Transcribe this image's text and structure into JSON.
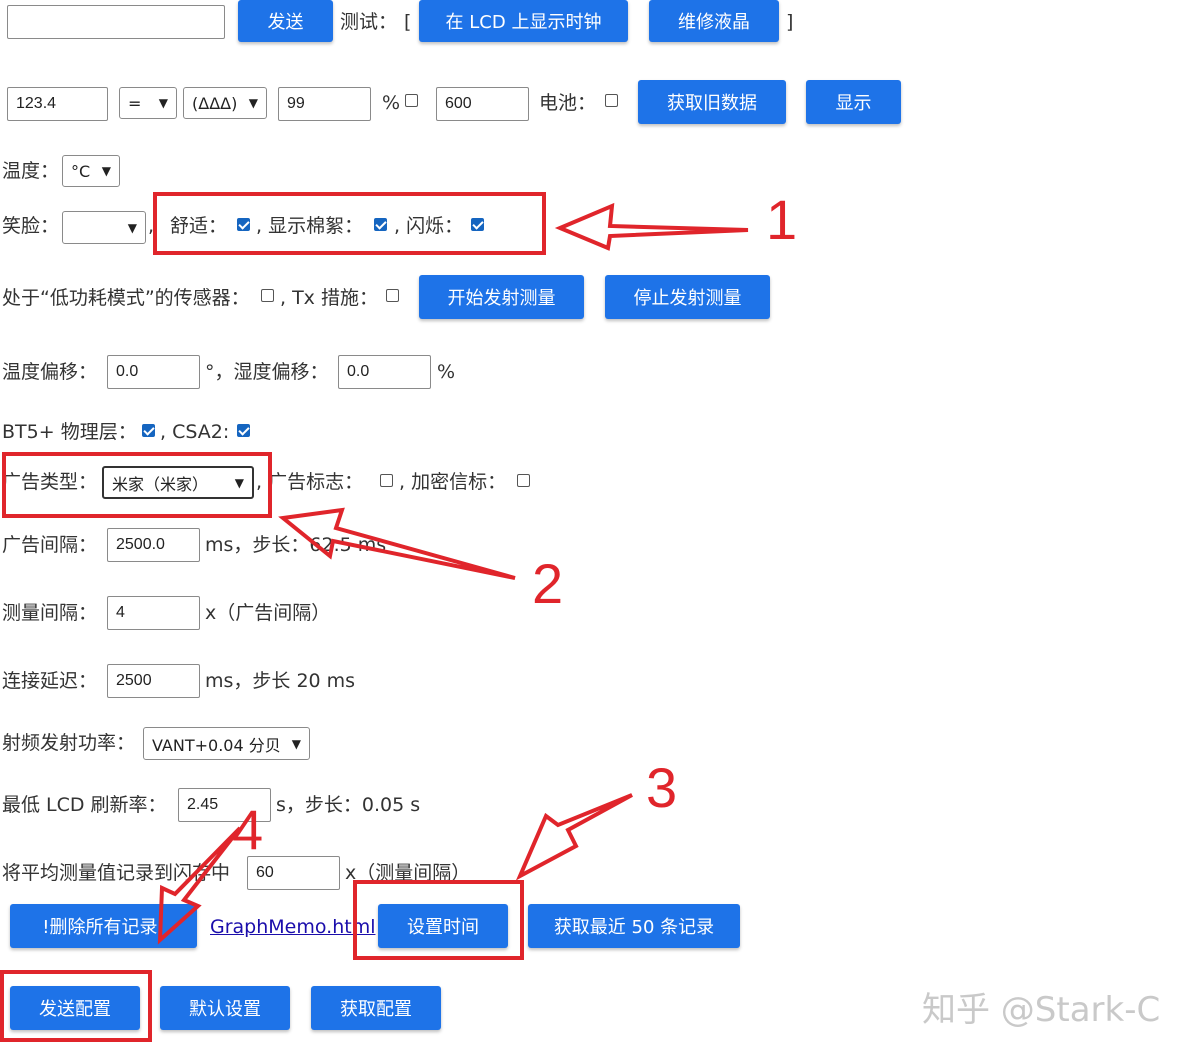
{
  "row1": {
    "send_label": "发送",
    "test_label": "测试：",
    "bracket_open": "[",
    "show_clock_label": "在 LCD 上显示时钟",
    "repair_lcd_label": "维修液晶",
    "bracket_close": "]"
  },
  "row2": {
    "value_input": "123.4",
    "operator_select": "=",
    "smiley_select": "(ΔΔΔ)",
    "percent_input": "99",
    "percent_label": "%",
    "battery_input": "600",
    "battery_label": "电池：",
    "get_old_data_label": "获取旧数据",
    "show_label": "显示"
  },
  "temperature": {
    "label": "温度：",
    "unit_select": "°C"
  },
  "smile": {
    "label": "笑脸：",
    "select": "",
    "comma": ",",
    "comfort_label": "舒适：",
    "comfort_checked": true,
    "show_flakes_label": ", 显示棉絮：",
    "show_flakes_checked": true,
    "blink_label": ", 闪烁：",
    "blink_checked": true
  },
  "sensor": {
    "low_power_label": "处于“低功耗模式”的传感器：",
    "low_power_checked": false,
    "tx_label": ", Tx 措施：",
    "tx_checked": false,
    "start_tx_label": "开始发射测量",
    "stop_tx_label": "停止发射测量"
  },
  "offsets": {
    "temp_offset_label": "温度偏移：",
    "temp_offset_value": "0.0",
    "temp_offset_unit": "°，湿度偏移：",
    "humidity_offset_value": "0.0",
    "humidity_offset_unit": "%"
  },
  "bt": {
    "phy_label": "BT5+ 物理层：",
    "phy_checked": true,
    "csa2_label": ", CSA2:",
    "csa2_checked": true
  },
  "adv": {
    "type_label": "广告类型：",
    "type_select": "米家（米家）",
    "flags_label": ", 广告标志：",
    "flags_checked": false,
    "encrypted_label": ", 加密信标：",
    "encrypted_checked": false,
    "interval_label": "广告间隔：",
    "interval_value": "2500.0",
    "interval_unit": "ms，步长：62.5 ms"
  },
  "measure": {
    "label": "测量间隔：",
    "value": "4",
    "unit": "x（广告间隔）"
  },
  "conn": {
    "label": "连接延迟：",
    "value": "2500",
    "unit": "ms，步长 20 ms"
  },
  "rf": {
    "label": "射频发射功率：",
    "select": "VANT+0.04 分贝"
  },
  "lcd_refresh": {
    "label": "最低 LCD 刷新率：",
    "value": "2.45",
    "unit": "s，步长：0.05 s"
  },
  "flash": {
    "label": "将平均测量值记录到闪存中",
    "value": "60",
    "unit": "x（测量间隔）"
  },
  "actions": {
    "delete_all_label": "!删除所有记录!",
    "graph_link": "GraphMemo.html",
    "set_time_label": "设置时间",
    "get_last_label": "获取最近 50 条记录",
    "send_config_label": "发送配置",
    "default_label": "默认设置",
    "get_config_label": "获取配置"
  },
  "annotations": {
    "n1": "1",
    "n2": "2",
    "n3": "3",
    "n4": "4",
    "color": "#e0252b"
  },
  "watermark": "知乎 @Stark-C",
  "colors": {
    "button": "#1e73e8",
    "annotation": "#e0252b",
    "checkbox": "#1565c0"
  }
}
